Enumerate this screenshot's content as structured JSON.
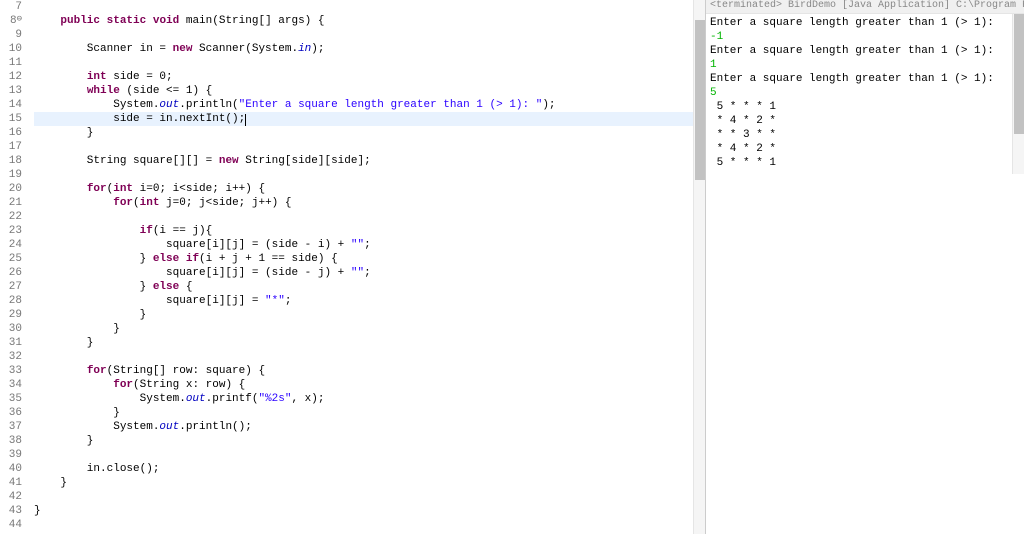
{
  "editor": {
    "highlightedLine": 15,
    "lines": [
      {
        "n": 7
      },
      {
        "n": 8,
        "anno": "⊖",
        "tokens": [
          {
            "t": "    ",
            "c": ""
          },
          {
            "t": "public",
            "c": "kw"
          },
          {
            "t": " ",
            "c": ""
          },
          {
            "t": "static",
            "c": "kw"
          },
          {
            "t": " ",
            "c": ""
          },
          {
            "t": "void",
            "c": "kw"
          },
          {
            "t": " main(String[] args) {",
            "c": ""
          }
        ]
      },
      {
        "n": 9
      },
      {
        "n": 10,
        "tokens": [
          {
            "t": "        Scanner in = ",
            "c": ""
          },
          {
            "t": "new",
            "c": "kw"
          },
          {
            "t": " Scanner(System.",
            "c": ""
          },
          {
            "t": "in",
            "c": "fld"
          },
          {
            "t": ");",
            "c": ""
          }
        ]
      },
      {
        "n": 11
      },
      {
        "n": 12,
        "tokens": [
          {
            "t": "        ",
            "c": ""
          },
          {
            "t": "int",
            "c": "kw"
          },
          {
            "t": " side = 0;",
            "c": ""
          }
        ]
      },
      {
        "n": 13,
        "tokens": [
          {
            "t": "        ",
            "c": ""
          },
          {
            "t": "while",
            "c": "kw"
          },
          {
            "t": " (side <= 1) {",
            "c": ""
          }
        ]
      },
      {
        "n": 14,
        "tokens": [
          {
            "t": "            System.",
            "c": ""
          },
          {
            "t": "out",
            "c": "fld"
          },
          {
            "t": ".println(",
            "c": ""
          },
          {
            "t": "\"Enter a square length greater than 1 (> 1): \"",
            "c": "str"
          },
          {
            "t": ");",
            "c": ""
          }
        ]
      },
      {
        "n": 15,
        "tokens": [
          {
            "t": "            side = in.nextInt();",
            "c": ""
          }
        ],
        "caret": true
      },
      {
        "n": 16,
        "tokens": [
          {
            "t": "        }",
            "c": ""
          }
        ]
      },
      {
        "n": 17
      },
      {
        "n": 18,
        "tokens": [
          {
            "t": "        String square[][] = ",
            "c": ""
          },
          {
            "t": "new",
            "c": "kw"
          },
          {
            "t": " String[side][side];",
            "c": ""
          }
        ]
      },
      {
        "n": 19
      },
      {
        "n": 20,
        "tokens": [
          {
            "t": "        ",
            "c": ""
          },
          {
            "t": "for",
            "c": "kw"
          },
          {
            "t": "(",
            "c": ""
          },
          {
            "t": "int",
            "c": "kw"
          },
          {
            "t": " i=0; i<side; i++) {",
            "c": ""
          }
        ]
      },
      {
        "n": 21,
        "tokens": [
          {
            "t": "            ",
            "c": ""
          },
          {
            "t": "for",
            "c": "kw"
          },
          {
            "t": "(",
            "c": ""
          },
          {
            "t": "int",
            "c": "kw"
          },
          {
            "t": " j=0; j<side; j++) {",
            "c": ""
          }
        ]
      },
      {
        "n": 22
      },
      {
        "n": 23,
        "tokens": [
          {
            "t": "                ",
            "c": ""
          },
          {
            "t": "if",
            "c": "kw"
          },
          {
            "t": "(i == j){",
            "c": ""
          }
        ]
      },
      {
        "n": 24,
        "tokens": [
          {
            "t": "                    square[i][j] = (side - i) + ",
            "c": ""
          },
          {
            "t": "\"\"",
            "c": "str"
          },
          {
            "t": ";",
            "c": ""
          }
        ]
      },
      {
        "n": 25,
        "tokens": [
          {
            "t": "                } ",
            "c": ""
          },
          {
            "t": "else",
            "c": "kw"
          },
          {
            "t": " ",
            "c": ""
          },
          {
            "t": "if",
            "c": "kw"
          },
          {
            "t": "(i + j + 1 == side) {",
            "c": ""
          }
        ]
      },
      {
        "n": 26,
        "tokens": [
          {
            "t": "                    square[i][j] = (side - j) + ",
            "c": ""
          },
          {
            "t": "\"\"",
            "c": "str"
          },
          {
            "t": ";",
            "c": ""
          }
        ]
      },
      {
        "n": 27,
        "tokens": [
          {
            "t": "                } ",
            "c": ""
          },
          {
            "t": "else",
            "c": "kw"
          },
          {
            "t": " {",
            "c": ""
          }
        ]
      },
      {
        "n": 28,
        "tokens": [
          {
            "t": "                    square[i][j] = ",
            "c": ""
          },
          {
            "t": "\"*\"",
            "c": "str"
          },
          {
            "t": ";",
            "c": ""
          }
        ]
      },
      {
        "n": 29,
        "tokens": [
          {
            "t": "                }",
            "c": ""
          }
        ]
      },
      {
        "n": 30,
        "tokens": [
          {
            "t": "            }",
            "c": ""
          }
        ]
      },
      {
        "n": 31,
        "tokens": [
          {
            "t": "        }",
            "c": ""
          }
        ]
      },
      {
        "n": 32
      },
      {
        "n": 33,
        "tokens": [
          {
            "t": "        ",
            "c": ""
          },
          {
            "t": "for",
            "c": "kw"
          },
          {
            "t": "(String[] row: square) {",
            "c": ""
          }
        ]
      },
      {
        "n": 34,
        "tokens": [
          {
            "t": "            ",
            "c": ""
          },
          {
            "t": "for",
            "c": "kw"
          },
          {
            "t": "(String x: row) {",
            "c": ""
          }
        ]
      },
      {
        "n": 35,
        "tokens": [
          {
            "t": "                System.",
            "c": ""
          },
          {
            "t": "out",
            "c": "fld"
          },
          {
            "t": ".printf(",
            "c": ""
          },
          {
            "t": "\"%2s\"",
            "c": "str"
          },
          {
            "t": ", x);",
            "c": ""
          }
        ]
      },
      {
        "n": 36,
        "tokens": [
          {
            "t": "            }",
            "c": ""
          }
        ]
      },
      {
        "n": 37,
        "tokens": [
          {
            "t": "            System.",
            "c": ""
          },
          {
            "t": "out",
            "c": "fld"
          },
          {
            "t": ".println();",
            "c": ""
          }
        ]
      },
      {
        "n": 38,
        "tokens": [
          {
            "t": "        }",
            "c": ""
          }
        ]
      },
      {
        "n": 39
      },
      {
        "n": 40,
        "tokens": [
          {
            "t": "        in.close();",
            "c": ""
          }
        ]
      },
      {
        "n": 41,
        "tokens": [
          {
            "t": "    }",
            "c": ""
          }
        ]
      },
      {
        "n": 42
      },
      {
        "n": 43,
        "tokens": [
          {
            "t": "}",
            "c": ""
          }
        ]
      },
      {
        "n": 44
      }
    ]
  },
  "console": {
    "header": "<terminated> BirdDemo [Java Application] C:\\Program Files\\Java\\jdk...",
    "lines": [
      {
        "t": "Enter a square length greater than 1 (> 1): ",
        "c": ""
      },
      {
        "t": "-1",
        "c": "user-in"
      },
      {
        "t": "Enter a square length greater than 1 (> 1): ",
        "c": ""
      },
      {
        "t": "1",
        "c": "user-in"
      },
      {
        "t": "Enter a square length greater than 1 (> 1): ",
        "c": ""
      },
      {
        "t": "5",
        "c": "user-in"
      },
      {
        "t": " 5 * * * 1",
        "c": ""
      },
      {
        "t": " * 4 * 2 *",
        "c": ""
      },
      {
        "t": " * * 3 * *",
        "c": ""
      },
      {
        "t": " * 4 * 2 *",
        "c": ""
      },
      {
        "t": " 5 * * * 1",
        "c": ""
      }
    ]
  }
}
